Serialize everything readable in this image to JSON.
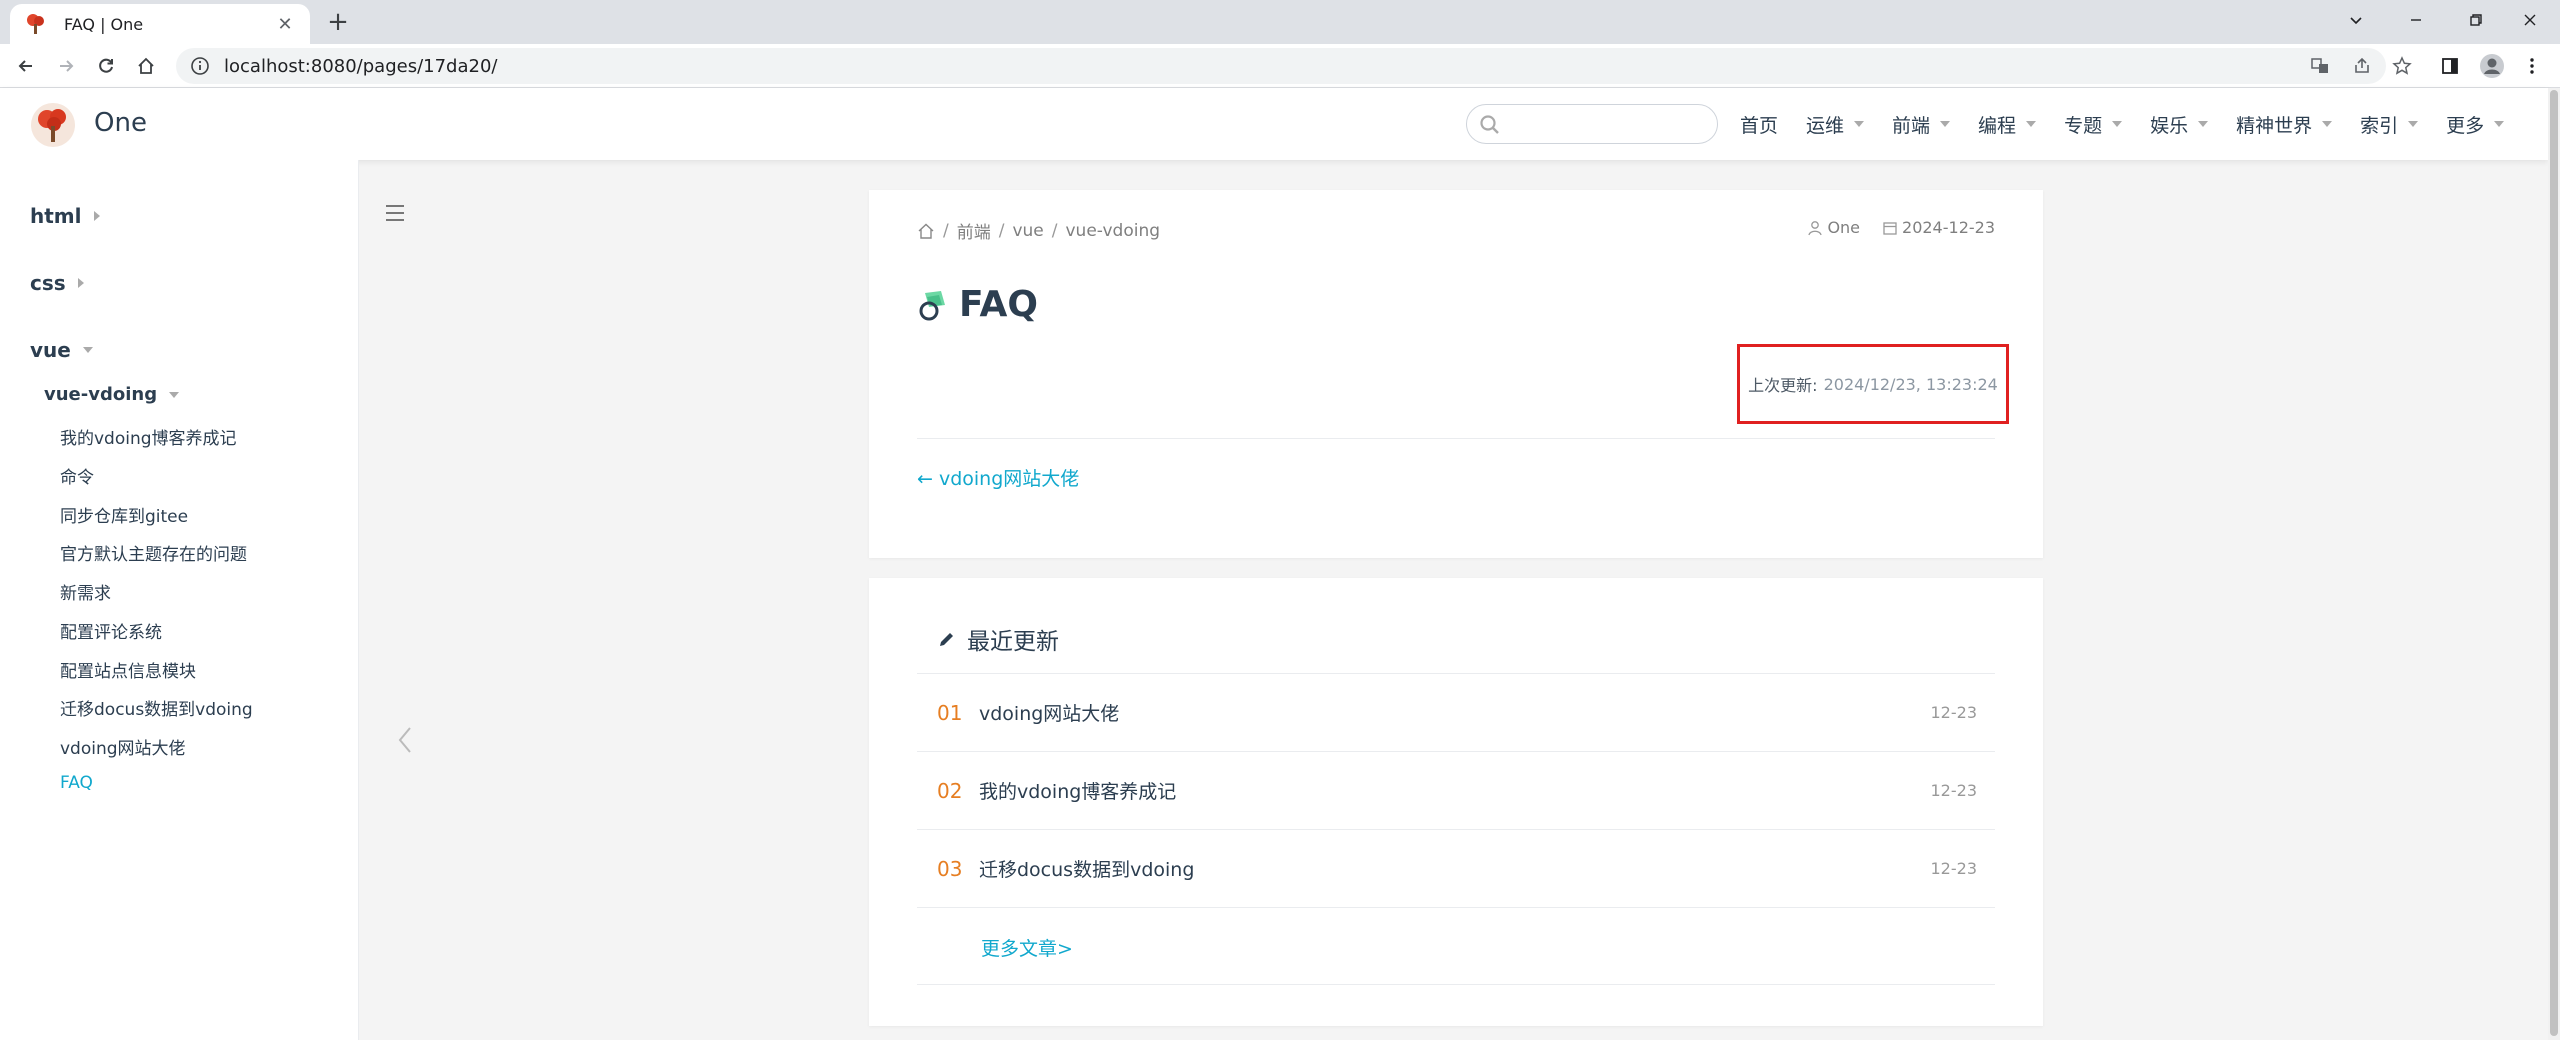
{
  "browser": {
    "tab_title": "FAQ | One",
    "url": "localhost:8080/pages/17da20/",
    "new_tab_symbol": "+",
    "close_symbol": "✕"
  },
  "site": {
    "title": "One",
    "search_placeholder": "",
    "nav": [
      "首页",
      "运维",
      "前端",
      "编程",
      "专题",
      "娱乐",
      "精神世界",
      "索引",
      "更多"
    ]
  },
  "sidebar": {
    "groups": [
      {
        "label": "html"
      },
      {
        "label": "css"
      },
      {
        "label": "vue"
      }
    ],
    "subgroup": "vue-vdoing",
    "items": [
      "我的vdoing博客养成记",
      "命令",
      "同步仓库到gitee",
      "官方默认主题存在的问题",
      "新需求",
      "配置评论系统",
      "配置站点信息模块",
      "迁移docus数据到vdoing",
      "vdoing网站大佬",
      "FAQ"
    ]
  },
  "article": {
    "breadcrumb": [
      "前端",
      "vue",
      "vue-vdoing"
    ],
    "author": "One",
    "date": "2024-12-23",
    "title": "FAQ",
    "last_updated_label": "上次更新:",
    "last_updated_value": "2024/12/23, 13:23:24",
    "prev_link": "← vdoing网站大佬"
  },
  "recent": {
    "heading": "最近更新",
    "items": [
      {
        "num": "01",
        "name": "vdoing网站大佬",
        "date": "12-23"
      },
      {
        "num": "02",
        "name": "我的vdoing博客养成记",
        "date": "12-23"
      },
      {
        "num": "03",
        "name": "迁移docus数据到vdoing",
        "date": "12-23"
      }
    ],
    "more": "更多文章>"
  },
  "colors": {
    "accent": "#11a8cd",
    "highlight_box": "#e02020",
    "recent_number": "#e67e22"
  }
}
